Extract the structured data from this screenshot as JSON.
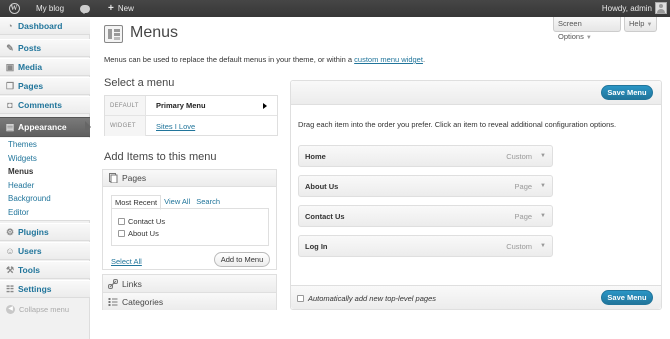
{
  "admin_bar": {
    "site_name": "My blog",
    "new_label": "New",
    "new_plus": "+",
    "howdy": "Howdy, admin"
  },
  "sidebar": {
    "items": [
      {
        "label": "Dashboard",
        "icon": "dashboard-icon",
        "glyph": "◔"
      },
      {
        "label": "Posts",
        "icon": "pin-icon",
        "glyph": "✎"
      },
      {
        "label": "Media",
        "icon": "media-icon",
        "glyph": "▣"
      },
      {
        "label": "Pages",
        "icon": "pages-icon",
        "glyph": "❐"
      },
      {
        "label": "Comments",
        "icon": "comments-icon",
        "glyph": "◘"
      },
      {
        "label": "Appearance",
        "icon": "appearance-icon",
        "glyph": "▤"
      },
      {
        "label": "Plugins",
        "icon": "plugins-icon",
        "glyph": "⚙"
      },
      {
        "label": "Users",
        "icon": "users-icon",
        "glyph": "☺"
      },
      {
        "label": "Tools",
        "icon": "tools-icon",
        "glyph": "⚒"
      },
      {
        "label": "Settings",
        "icon": "settings-icon",
        "glyph": "☷"
      }
    ],
    "submenu": [
      "Themes",
      "Widgets",
      "Menus",
      "Header",
      "Background",
      "Editor"
    ],
    "collapse_label": "Collapse menu"
  },
  "screen_meta": {
    "screen_options": "Screen Options",
    "help": "Help",
    "arrow": "▼"
  },
  "page": {
    "title": "Menus",
    "intro_text": "Menus can be used to replace the default menus in your theme, or within a ",
    "intro_link": "custom menu widget",
    "intro_end": "."
  },
  "select_menu": {
    "heading": "Select a menu",
    "rows": [
      {
        "key": "DEFAULT",
        "value": "Primary Menu"
      },
      {
        "key": "WIDGET",
        "value": "Sites I Love"
      }
    ]
  },
  "add_items": {
    "heading": "Add Items to this menu",
    "pages_title": "Pages",
    "tabs": [
      "Most Recent",
      "View All",
      "Search"
    ],
    "pages": [
      "Contact Us",
      "About Us"
    ],
    "select_all": "Select All",
    "add_button": "Add to Menu",
    "links_title": "Links",
    "categories_title": "Categories"
  },
  "editor": {
    "save_label": "Save Menu",
    "instructions": "Drag each item into the order you prefer. Click an item to reveal additional configuration options.",
    "items": [
      {
        "title": "Home",
        "type": "Custom"
      },
      {
        "title": "About Us",
        "type": "Page"
      },
      {
        "title": "Contact Us",
        "type": "Page"
      },
      {
        "title": "Log In",
        "type": "Custom"
      }
    ],
    "expand_arrow": "▼",
    "auto_add_label": "Automatically add new top-level pages"
  },
  "colors": {
    "link": "#21759b",
    "admin_bar": "#464646",
    "primary_button": "#21759b"
  }
}
